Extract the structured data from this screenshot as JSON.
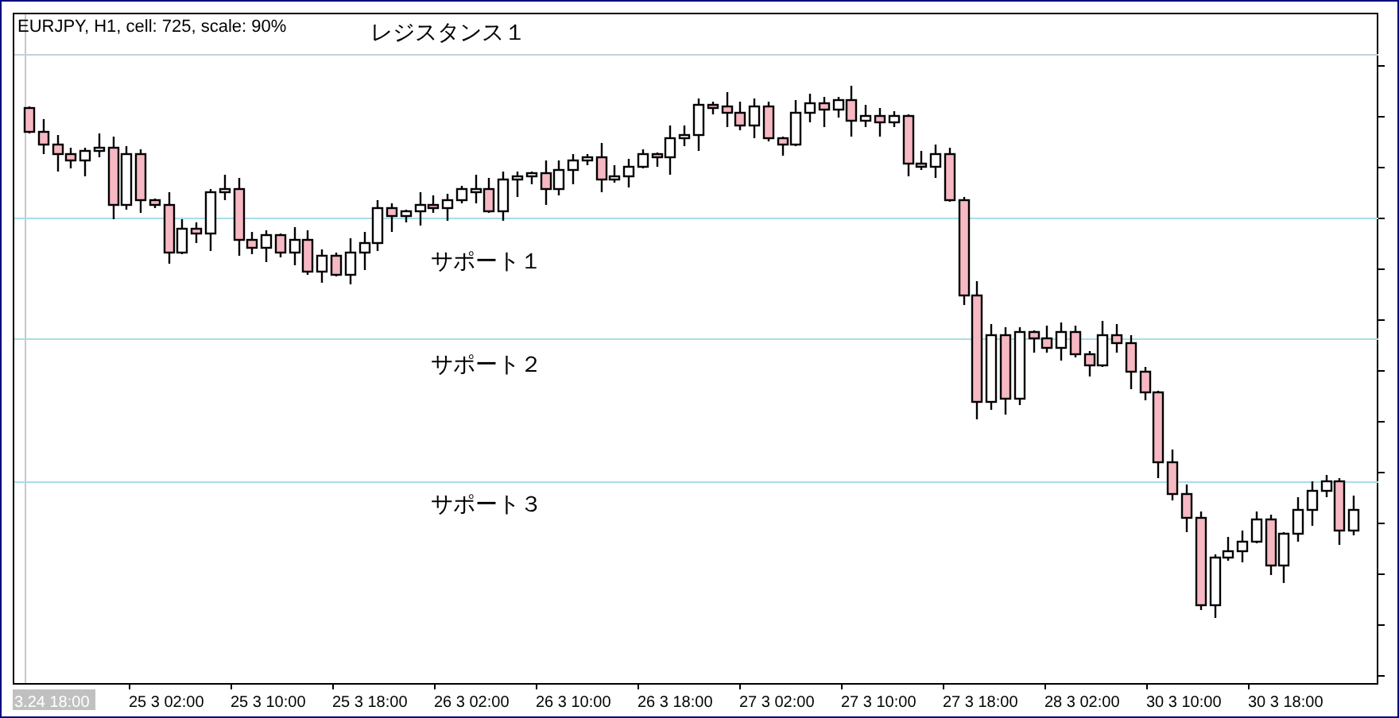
{
  "chart_header": "EURJPY, H1, cell: 725, scale: 90%",
  "levels": [
    {
      "kind": "resistance",
      "label": "レジスタンス１"
    },
    {
      "kind": "support",
      "label": "サポート１"
    },
    {
      "kind": "support",
      "label": "サポート２"
    },
    {
      "kind": "support",
      "label": "サポート３"
    }
  ],
  "time_axis": [
    {
      "label": "3.24 18:00",
      "selected": true
    },
    {
      "label": "25 3 02:00",
      "selected": false
    },
    {
      "label": "25 3 10:00",
      "selected": false
    },
    {
      "label": "25 3 18:00",
      "selected": false
    },
    {
      "label": "26 3 02:00",
      "selected": false
    },
    {
      "label": "26 3 10:00",
      "selected": false
    },
    {
      "label": "26 3 18:00",
      "selected": false
    },
    {
      "label": "27 3 02:00",
      "selected": false
    },
    {
      "label": "27 3 10:00",
      "selected": false
    },
    {
      "label": "27 3 18:00",
      "selected": false
    },
    {
      "label": "28 3 02:00",
      "selected": false
    },
    {
      "label": "30 3 10:00",
      "selected": false
    },
    {
      "label": "30 3 18:00",
      "selected": false
    }
  ]
}
